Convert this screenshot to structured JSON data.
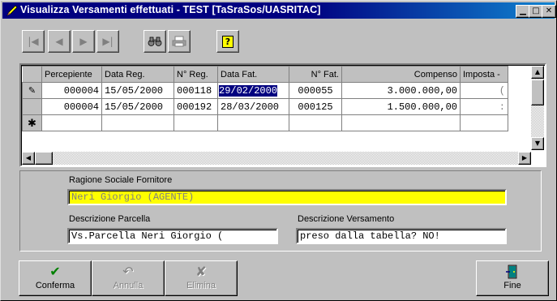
{
  "window": {
    "title": "Visualizza Versamenti effettuati - TEST [TaSraSos/UASRITAC]"
  },
  "titlebar_buttons": {
    "minimize": "▁",
    "maximize": "□",
    "close": "✕"
  },
  "toolbar": {
    "first": "|◀",
    "prev": "◀",
    "next": "▶",
    "last": "▶|",
    "find_icon": "binoculars-icon",
    "print_icon": "printer-icon",
    "help_icon": "help-icon",
    "help_glyph": "?"
  },
  "grid": {
    "columns": [
      "Percepiente",
      "Data Reg.",
      "N° Reg.",
      "Data Fat.",
      "N° Fat.",
      "Compenso",
      "Imposta - "
    ],
    "rows": [
      {
        "indicator": "✎",
        "cells": [
          "000004",
          "15/05/2000",
          "000118",
          "29/02/2000",
          "000055",
          "3.000.000,00",
          "("
        ]
      },
      {
        "indicator": "",
        "cells": [
          "000004",
          "15/05/2000",
          "000192",
          "28/03/2000",
          "000125",
          "1.500.000,00",
          ":"
        ]
      },
      {
        "indicator": "✱",
        "cells": [
          "",
          "",
          "",
          "",
          "",
          "",
          ""
        ]
      }
    ]
  },
  "form": {
    "ragione_label": "Ragione Sociale Fornitore",
    "ragione_value": "Neri Giorgio (AGENTE)",
    "desc_parcella_label": "Descrizione Parcella",
    "desc_parcella_value": "Vs.Parcella Neri Giorgio (",
    "desc_versamento_label": "Descrizione Versamento",
    "desc_versamento_value": "preso dalla tabella? NO!"
  },
  "buttons": {
    "conferma": "Conferma",
    "annulla": "Annulla",
    "elimina": "Elimina",
    "fine": "Fine"
  },
  "colors": {
    "highlight_field": "#ffff00",
    "title_bg": "#000080"
  }
}
